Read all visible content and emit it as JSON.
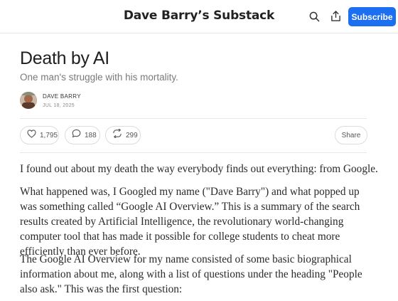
{
  "header": {
    "publication_title": "Dave Barry’s Substack",
    "subscribe_label": "Subscribe",
    "icons": [
      "search-icon",
      "share-upload-icon"
    ]
  },
  "post": {
    "title": "Death by AI",
    "subtitle": "One man's struggle with his mortality.",
    "author": "DAVE BARRY",
    "date": "JUL 18, 2025"
  },
  "engagement": {
    "likes": "1,795",
    "comments": "188",
    "restacks": "299",
    "share_label": "Share"
  },
  "body": {
    "p1": "I found out about my death the way everybody finds out everything: from Google.",
    "p2": "What happened was, I Googled my name (\"Dave Barry\") and what popped up was something called “Google AI Overview.” This is a summary of the search results created by Artificial Intelligence, the revolutionary world-changing computer tool that has made it possible for college students to cheat more efficiently than ever before.",
    "p3": "The Google AI Overview for my name consisted of some basic biographical information about me, along with a list of questions under the heading \"People also ask.\" This was the first question:"
  },
  "colors": {
    "accent": "#1d6ff2",
    "divider": "#e8e8e8",
    "subtitle": "#7a7a7a"
  }
}
